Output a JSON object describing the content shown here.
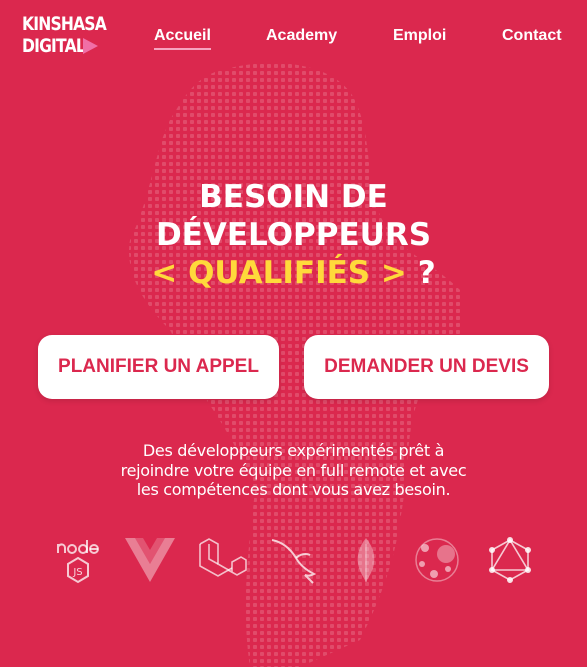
{
  "brand": {
    "logo_line1": "KINSHASA",
    "logo_line2": "DIGITAL",
    "color_bg": "#db284e",
    "color_highlight": "#ffd93b"
  },
  "nav": {
    "items": [
      {
        "label": "Accueil",
        "active": true
      },
      {
        "label": "Academy",
        "active": false
      },
      {
        "label": "Emploi",
        "active": false
      },
      {
        "label": "Contact",
        "active": false
      }
    ]
  },
  "hero": {
    "line1": "BESOIN DE",
    "line2": "DÉVELOPPEURS",
    "line3_highlight": "< QUALIFIÉS >",
    "line3_suffix": " ?"
  },
  "actions": {
    "call_label": "PLANIFIER UN APPEL",
    "quote_label": "DEMANDER UN DEVIS"
  },
  "description": {
    "line1": "Des développeurs expérimentés prêt à",
    "line2": "rejoindre votre équipe en full remote et avec",
    "line3": "les compétences dont vous avez besoin."
  },
  "technologies": [
    {
      "name": "nodejs-icon"
    },
    {
      "name": "vuejs-icon"
    },
    {
      "name": "laravel-icon"
    },
    {
      "name": "mysql-icon"
    },
    {
      "name": "mongodb-icon"
    },
    {
      "name": "neo4j-icon"
    },
    {
      "name": "graphql-icon"
    }
  ]
}
